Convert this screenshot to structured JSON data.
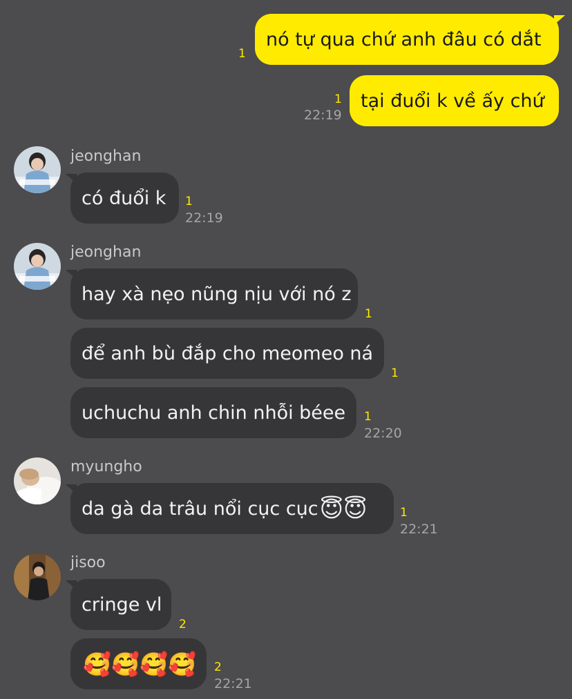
{
  "messages": {
    "out_1": {
      "text": "nó tự qua chứ anh đâu có dắt",
      "unread": "1"
    },
    "out_2": {
      "text": "tại đuổi k về ấy chứ",
      "unread": "1",
      "time": "22:19"
    },
    "jeonghan_1": {
      "sender": "jeonghan",
      "avatar": "jeonghan-avatar",
      "text": "có đuổi k",
      "unread": "1",
      "time": "22:19"
    },
    "jeonghan_2": {
      "sender": "jeonghan",
      "avatar": "jeonghan-avatar",
      "lines": [
        {
          "text": "hay xà nẹo nũng nịu với nó z",
          "unread": "1"
        },
        {
          "text": "để anh bù đắp cho meomeo ná",
          "unread": "1"
        },
        {
          "text": "uchuchu anh chin nhỗi béee",
          "unread": "1"
        }
      ],
      "time": "22:20"
    },
    "myungho": {
      "sender": "myungho",
      "avatar": "myungho-avatar",
      "text": "da gà da trâu nổi cục cục",
      "emoji": "😇😇",
      "unread": "1",
      "time": "22:21"
    },
    "jisoo": {
      "sender": "jisoo",
      "avatar": "jisoo-avatar",
      "lines": [
        {
          "text": "cringe vl",
          "unread": "2"
        },
        {
          "text": "🥰🥰🥰🥰",
          "unread": "2"
        }
      ],
      "time": "22:21"
    }
  },
  "colors": {
    "background": "#4c4b4d",
    "outgoing_bubble": "#ffeb00",
    "incoming_bubble": "#363638",
    "unread_count": "#ffeb00",
    "timestamp": "#a6a6a8"
  }
}
